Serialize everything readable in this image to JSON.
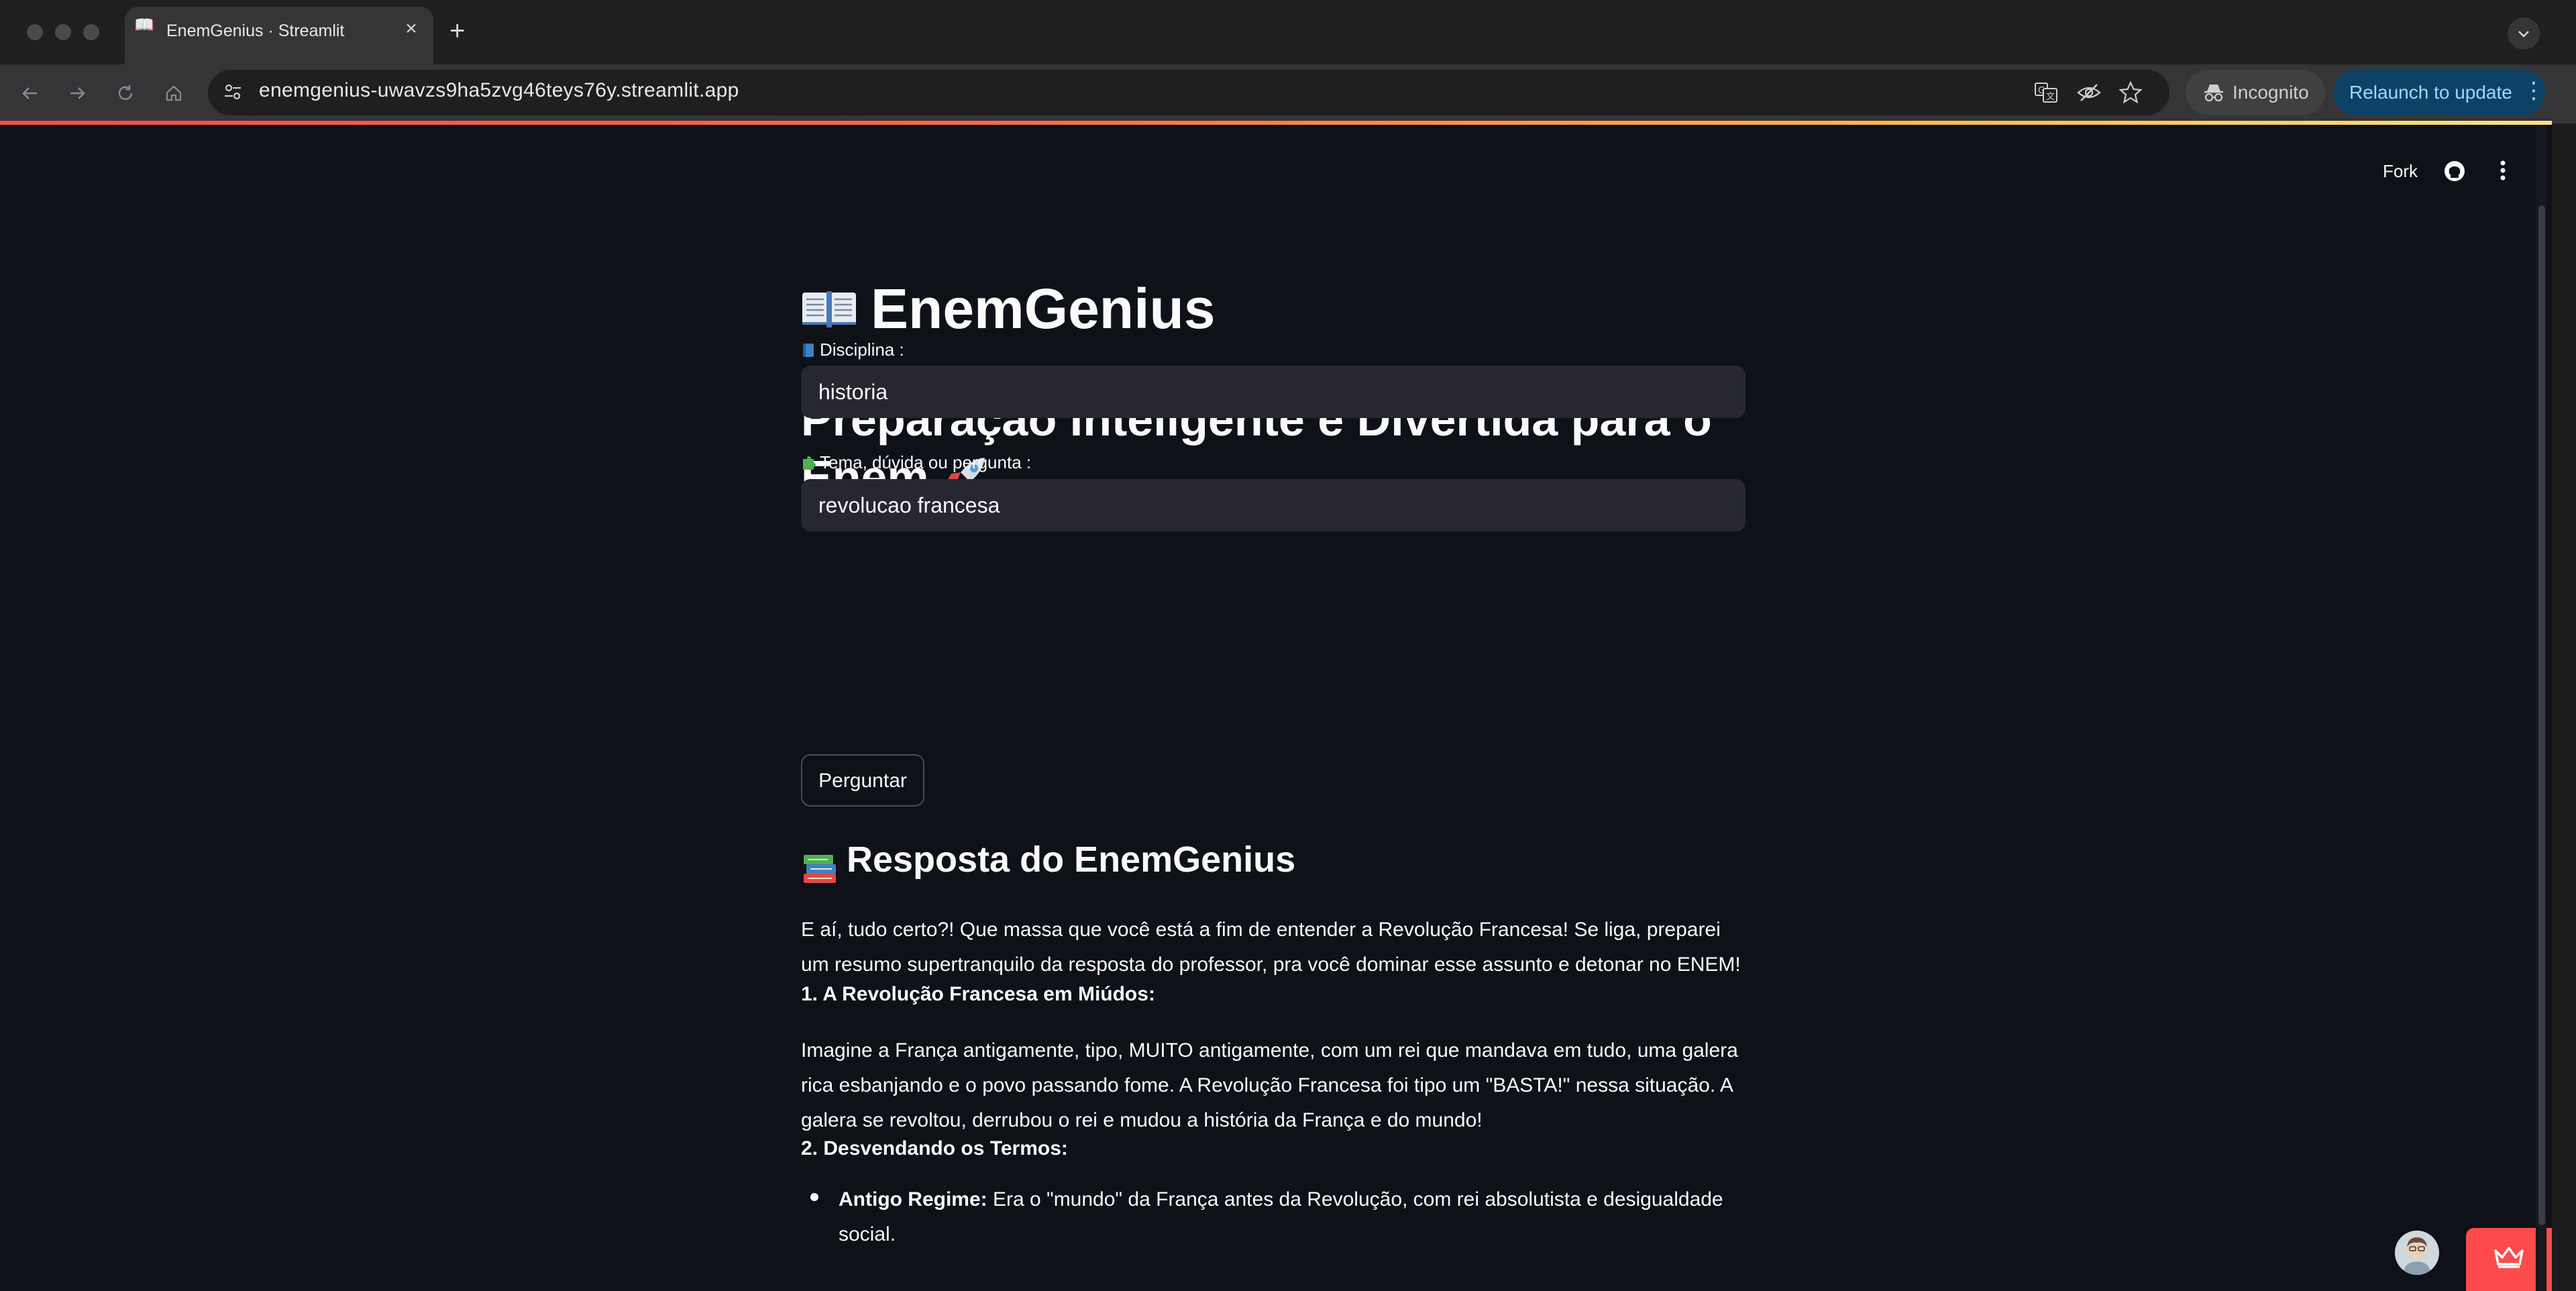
{
  "browser": {
    "tab_title": "EnemGenius · Streamlit",
    "url": "enemgenius-uwavzs9ha5zvg46teys76y.streamlit.app",
    "incognito_label": "Incognito",
    "relaunch_label": "Relaunch to update"
  },
  "header": {
    "fork_label": "Fork"
  },
  "app": {
    "title": "EnemGenius",
    "subtitle": "Preparação Inteligente e Divertida para o Enem.",
    "discipline_label": "Disciplina :",
    "discipline_value": "historia",
    "topic_label": "Tema, dúvida ou pergunta :",
    "topic_value": "revolucao francesa",
    "ask_button": "Perguntar",
    "answer_heading": "Resposta do EnemGenius",
    "intro": "E aí, tudo certo?! Que massa que você está a fim de entender a Revolução Francesa! Se liga, preparei um resumo supertranquilo da resposta do professor, pra você dominar esse assunto e detonar no ENEM!",
    "section1_heading": "1. A Revolução Francesa em Miúdos:",
    "section1_text": "Imagine a França antigamente, tipo, MUITO antigamente, com um rei que mandava em tudo, uma galera rica esbanjando e o povo passando fome. A Revolução Francesa foi tipo um \"BASTA!\" nessa situação. A galera se revoltou, derrubou o rei e mudou a história da França e do mundo!",
    "section2_heading": "2. Desvendando os Termos:",
    "bullet1_term": "Antigo Regime:",
    "bullet1_text": " Era o \"mundo\" da França antes da Revolução, com rei absolutista e desigualdade social."
  },
  "colors": {
    "app_background": "#0e1117",
    "input_background": "#262730",
    "accent": "#ff4b4b",
    "text": "#fafafa"
  }
}
